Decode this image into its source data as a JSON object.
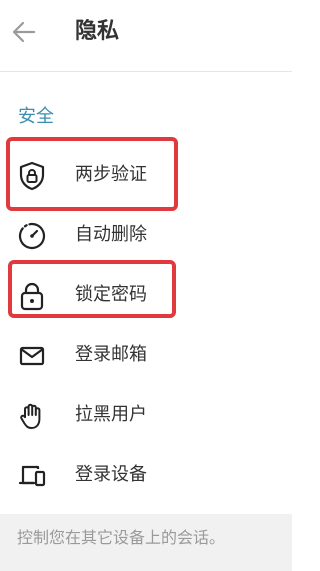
{
  "header": {
    "title": "隐私",
    "back_icon": "arrow-left-icon"
  },
  "section": {
    "title": "安全"
  },
  "items": [
    {
      "label": "两步验证",
      "icon": "shield-lock-icon",
      "highlighted": true
    },
    {
      "label": "自动删除",
      "icon": "timer-icon",
      "highlighted": false
    },
    {
      "label": "锁定密码",
      "icon": "lock-icon",
      "highlighted": true
    },
    {
      "label": "登录邮箱",
      "icon": "mail-icon",
      "highlighted": false
    },
    {
      "label": "拉黑用户",
      "icon": "hand-icon",
      "highlighted": false
    },
    {
      "label": "登录设备",
      "icon": "devices-icon",
      "highlighted": false
    }
  ],
  "footer": {
    "text": "控制您在其它设备上的会话。"
  },
  "colors": {
    "accent": "#3a8fb0",
    "highlight": "#e0393e",
    "text": "#333333",
    "muted": "#9a9a9a"
  }
}
